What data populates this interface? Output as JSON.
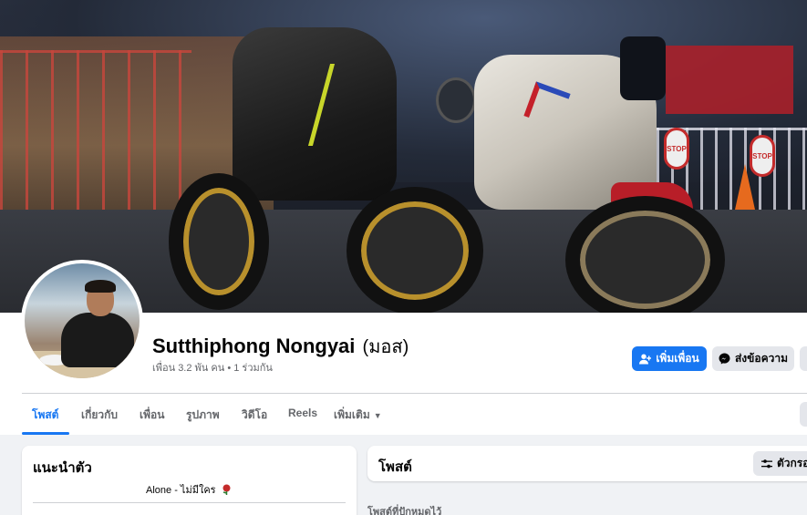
{
  "profile": {
    "name": "Sutthiphong Nongyai",
    "alt_name": "(มอส)",
    "friends": "เพื่อน 3.2 พัน คน",
    "mutual": "1 ร่วมกัน",
    "dot": "•"
  },
  "cover": {
    "stop_sign_text": "STOP"
  },
  "actions": {
    "add_friend": "เพิ่มเพื่อน",
    "message": "ส่งข้อความ"
  },
  "tabs": [
    {
      "label": "โพสต์"
    },
    {
      "label": "เกี่ยวกับ"
    },
    {
      "label": "เพื่อน"
    },
    {
      "label": "รูปภาพ"
    },
    {
      "label": "วิดีโอ"
    },
    {
      "label": "Reels"
    },
    {
      "label": "เพิ่มเติม"
    }
  ],
  "intro": {
    "title": "แนะนำตัว",
    "bio": "Alone - ไม่มีใคร"
  },
  "posts": {
    "title": "โพสต์",
    "filter_label": "ตัวกรอ",
    "pinned_label": "โพสต์ที่ปักหมุดไว้"
  },
  "colors": {
    "accent": "#1877f2",
    "background": "#f0f2f5",
    "secondary_button": "#e4e6eb"
  }
}
